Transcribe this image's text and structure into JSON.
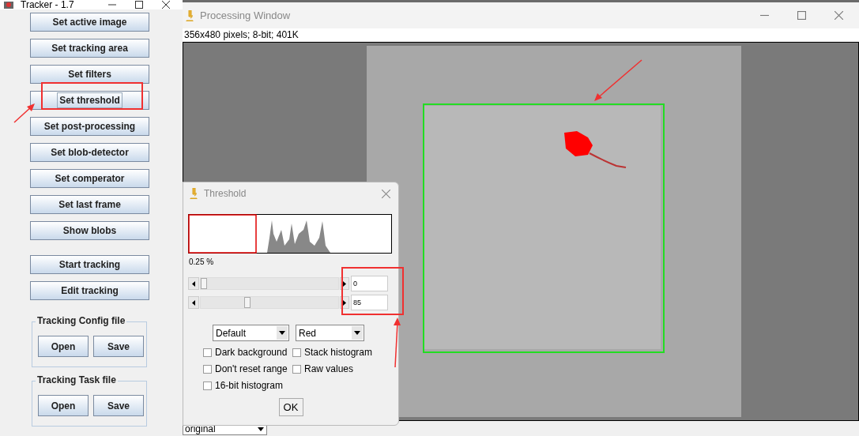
{
  "tracker_window": {
    "title": "Tracker - 1.7",
    "buttons": [
      {
        "label": "Set active image",
        "focused": false
      },
      {
        "label": "Set tracking area",
        "focused": false
      },
      {
        "label": "Set filters",
        "focused": false
      },
      {
        "label": "Set threshold",
        "focused": true
      },
      {
        "label": "Set post-processing",
        "focused": false
      },
      {
        "label": "Set blob-detector",
        "focused": false
      },
      {
        "label": "Set comperator",
        "focused": false
      },
      {
        "label": "Set last frame",
        "focused": false
      },
      {
        "label": "Show blobs",
        "focused": false
      }
    ],
    "tracking_buttons": [
      {
        "label": "Start tracking",
        "focused": false
      },
      {
        "label": "Edit tracking",
        "focused": false
      }
    ],
    "file_groups": [
      {
        "title": "Tracking Config file",
        "buttons": [
          "Open",
          "Save"
        ]
      },
      {
        "title": "Tracking Task file",
        "buttons": [
          "Open",
          "Save"
        ]
      }
    ]
  },
  "processing_window": {
    "title": "Processing Window",
    "info": "356x480 pixels; 8-bit; 401K",
    "view_dropdown": "original"
  },
  "threshold_dialog": {
    "title": "Threshold",
    "percent": "0.25 %",
    "sliders": [
      {
        "level": 0,
        "value": "0"
      },
      {
        "level": 0.33,
        "value": "85"
      }
    ],
    "method": "Default",
    "mode": "Red",
    "checkboxes": [
      {
        "label": "Dark background",
        "checked": false
      },
      {
        "label": "Stack histogram",
        "checked": false
      },
      {
        "label": "Don't reset range",
        "checked": false
      },
      {
        "label": "Raw values",
        "checked": false
      },
      {
        "label": "16-bit histogram",
        "checked": false
      }
    ],
    "ok": "OK"
  }
}
